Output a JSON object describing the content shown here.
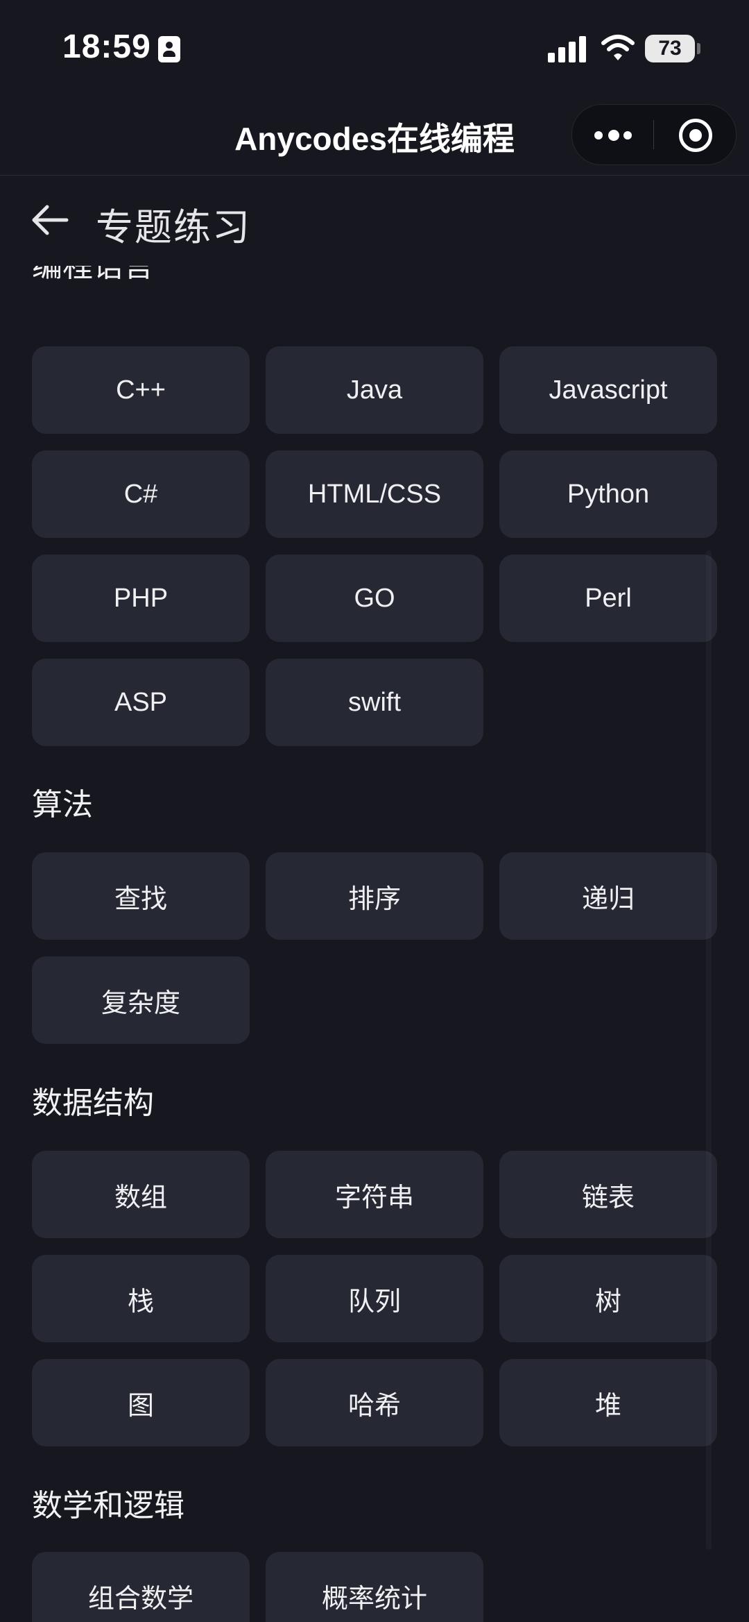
{
  "status_bar": {
    "time": "18:59",
    "battery": "73"
  },
  "title_bar": {
    "app_title": "Anycodes在线编程"
  },
  "header": {
    "title": "专题练习"
  },
  "sections": [
    {
      "title": "编程语言",
      "tags": [
        "C++",
        "Java",
        "Javascript",
        "C#",
        "HTML/CSS",
        "Python",
        "PHP",
        "GO",
        "Perl",
        "ASP",
        "swift"
      ]
    },
    {
      "title": "算法",
      "tags": [
        "查找",
        "排序",
        "递归",
        "复杂度"
      ]
    },
    {
      "title": "数据结构",
      "tags": [
        "数组",
        "字符串",
        "链表",
        "栈",
        "队列",
        "树",
        "图",
        "哈希",
        "堆"
      ]
    },
    {
      "title": "数学和逻辑",
      "tags": [
        "组合数学",
        "概率统计"
      ]
    }
  ]
}
